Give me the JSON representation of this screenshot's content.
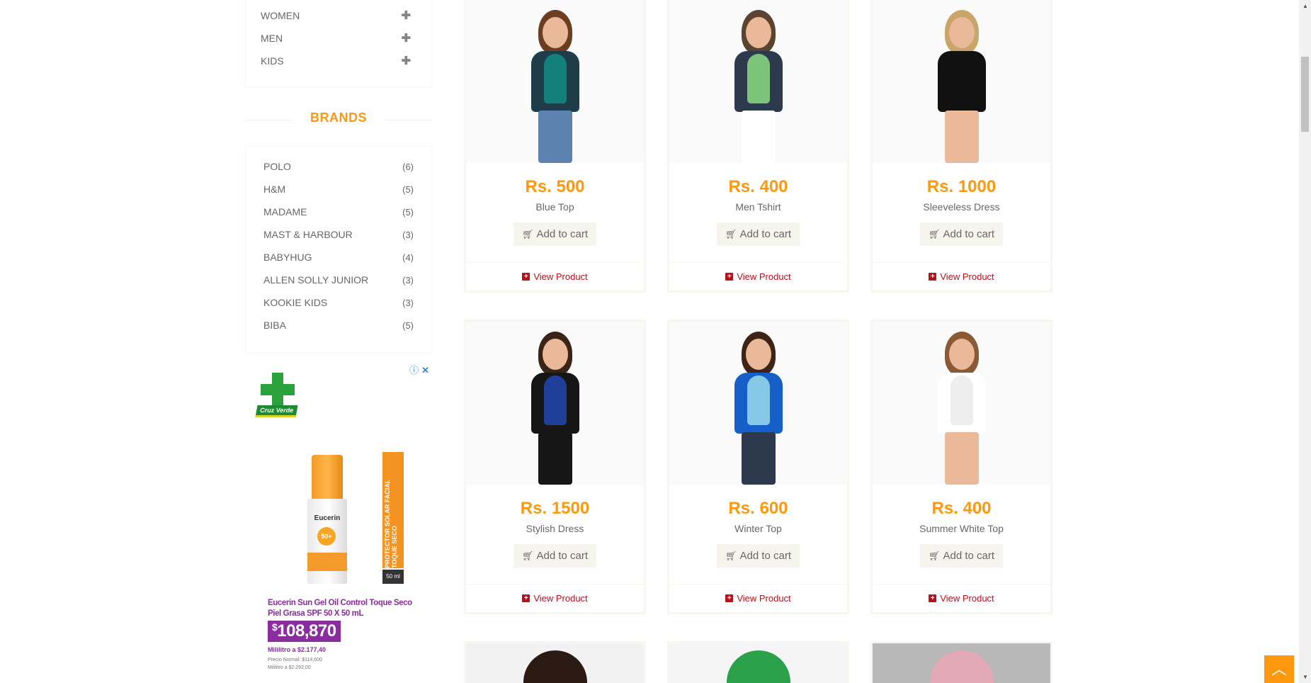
{
  "categories": [
    {
      "label": "WOMEN"
    },
    {
      "label": "MEN"
    },
    {
      "label": "KIDS"
    }
  ],
  "brands_title": "BRANDS",
  "brands": [
    {
      "name": "POLO",
      "count": "(6)"
    },
    {
      "name": "H&M",
      "count": "(5)"
    },
    {
      "name": "MADAME",
      "count": "(5)"
    },
    {
      "name": "MAST & HARBOUR",
      "count": "(3)"
    },
    {
      "name": "BABYHUG",
      "count": "(4)"
    },
    {
      "name": "ALLEN SOLLY JUNIOR",
      "count": "(3)"
    },
    {
      "name": "KOOKIE KIDS",
      "count": "(3)"
    },
    {
      "name": "BIBA",
      "count": "(5)"
    }
  ],
  "ad": {
    "logo_text": "Cruz Verde",
    "bottle_brand": "Eucerin",
    "bottle_spf": "50+",
    "side_text": "PROTECTOR SOLAR FACIAL TOQUE SECO",
    "volume": "50 ml",
    "title": "Eucerin Sun Gel Oil Control Toque Seco Piel Grasa SPF 50 X 50 mL",
    "price_symbol": "$",
    "price": "108,870",
    "per_ml": "Mililitro a $2.177,40",
    "normal_price": "Precio Normal: $114,600",
    "normal_per_ml": "Mililitro a $2.292,00"
  },
  "products": [
    {
      "price": "Rs. 500",
      "name": "Blue Top",
      "add_label": "Add to cart",
      "view_label": "View Product",
      "palette": {
        "top": "#1f3c4a",
        "inner": "#14807d",
        "bottom": "#5d82b0",
        "hair": "#6b3e22"
      }
    },
    {
      "price": "Rs. 400",
      "name": "Men Tshirt",
      "add_label": "Add to cart",
      "view_label": "View Product",
      "palette": {
        "top": "#2d3a4d",
        "inner": "#7bc47a",
        "bottom": "#ffffff",
        "hair": "#5a4330"
      }
    },
    {
      "price": "Rs. 1000",
      "name": "Sleeveless Dress",
      "add_label": "Add to cart",
      "view_label": "View Product",
      "palette": {
        "top": "#111111",
        "inner": "#111111",
        "bottom": "#e9b99a",
        "hair": "#c9a56a"
      }
    },
    {
      "price": "Rs. 1500",
      "name": "Stylish Dress",
      "add_label": "Add to cart",
      "view_label": "View Product",
      "palette": {
        "top": "#161616",
        "inner": "#1f3f99",
        "bottom": "#161616",
        "hair": "#3a2418"
      }
    },
    {
      "price": "Rs. 600",
      "name": "Winter Top",
      "add_label": "Add to cart",
      "view_label": "View Product",
      "palette": {
        "top": "#1460c8",
        "inner": "#86c9e6",
        "bottom": "#2d3a4d",
        "hair": "#3d2417"
      }
    },
    {
      "price": "Rs. 400",
      "name": "Summer White Top",
      "add_label": "Add to cart",
      "view_label": "View Product",
      "palette": {
        "top": "#ffffff",
        "inner": "#eeeeee",
        "bottom": "#e9b99a",
        "hair": "#8a5a35"
      }
    }
  ],
  "partial_products": [
    {
      "bg": "#f2f2f2",
      "accent": "#2a1a12"
    },
    {
      "bg": "#f5f5f5",
      "accent": "#2aa14a"
    },
    {
      "bg": "#b8b8b8",
      "accent": "#e3a9b6"
    }
  ],
  "colors": {
    "accent": "#fe980f",
    "link": "#b4121c"
  }
}
